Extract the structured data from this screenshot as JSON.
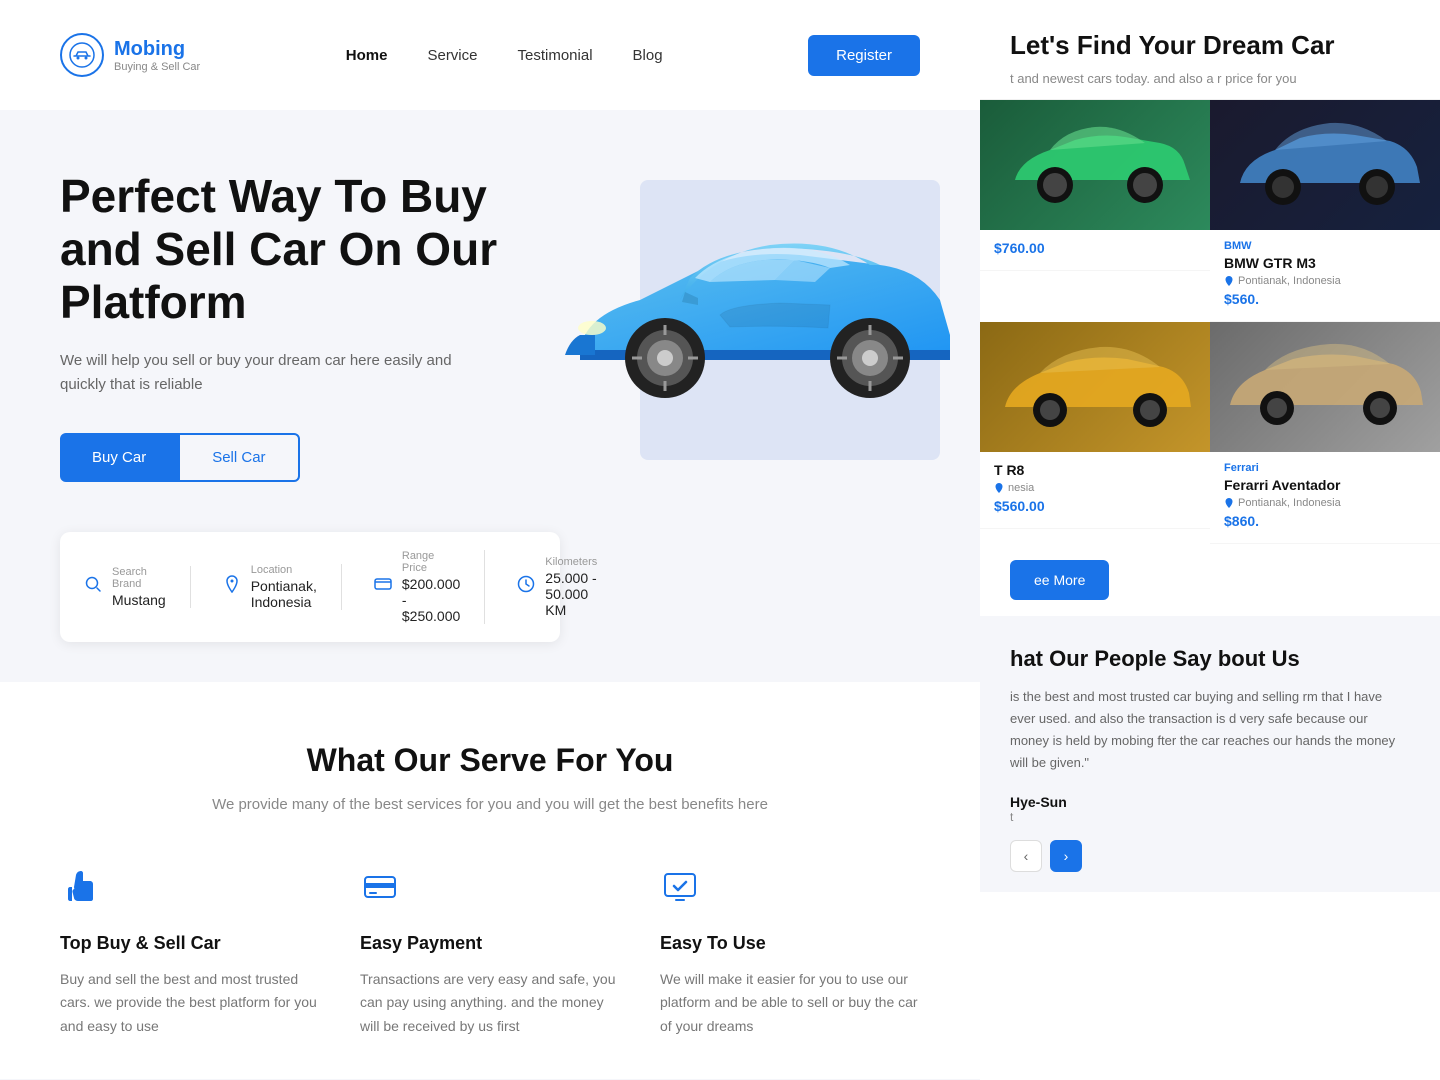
{
  "logo": {
    "name": "Mobing",
    "subtitle": "Buying & Sell Car"
  },
  "nav": {
    "items": [
      {
        "label": "Home",
        "active": true
      },
      {
        "label": "Service",
        "active": false
      },
      {
        "label": "Testimonial",
        "active": false
      },
      {
        "label": "Blog",
        "active": false
      }
    ],
    "register_label": "Register"
  },
  "hero": {
    "title": "Perfect Way To Buy and Sell Car On Our Platform",
    "description": "We will help you sell or buy your dream car here easily and quickly that is reliable",
    "btn_buy": "Buy Car",
    "btn_sell": "Sell Car"
  },
  "search": {
    "brand_label": "Search Brand",
    "brand_value": "Mustang",
    "location_label": "Location",
    "location_value": "Pontianak, Indonesia",
    "price_label": "Range Price",
    "price_value": "$200.000 - $250.000",
    "km_label": "Kilometers",
    "km_value": "25.000 - 50.000 KM"
  },
  "services": {
    "section_title": "What Our Serve For You",
    "section_desc": "We provide many of the best services for you and you will get the\nbest benefits here",
    "cards": [
      {
        "name": "Top Buy & Sell Car",
        "description": "Buy and sell the best and most trusted cars. we provide the best platform for you and easy to use"
      },
      {
        "name": "Easy Payment",
        "description": "Transactions are very easy and safe, you can pay using anything. and the money will be received by us first"
      },
      {
        "name": "Easy To Use",
        "description": "We will make it easier for you to use our platform and be able to sell or buy the car of your dreams"
      }
    ]
  },
  "right_panel": {
    "title": "Let's Find Your Dream Car",
    "description": "t and newest cars today. and also a\nr price for you",
    "cars": [
      {
        "brand": "",
        "model": "",
        "location": "",
        "price": "$760.00",
        "color_class": "car-green"
      },
      {
        "brand": "BMW",
        "model": "BMW GTR M3",
        "location": "Pontianak, Indonesia",
        "price": "$560.",
        "color_class": "car-bmw"
      },
      {
        "brand": "",
        "model": "T R8",
        "location": "nesia",
        "price": "$560.00",
        "color_class": "car-audi"
      },
      {
        "brand": "Ferrari",
        "model": "Ferarri Aventador",
        "location": "Pontianak, Indonesia",
        "price": "$860.",
        "color_class": "car-ferrari"
      }
    ],
    "see_more_label": "ee More",
    "testimonial": {
      "title": "hat Our People Say\nbout Us",
      "text": "is the best and most trusted car buying and selling rm that I have ever used. and also the transaction is d very safe because our money is held by mobing fter the car reaches our hands the money will be given.\"",
      "author": "Hye-Sun",
      "role": "t"
    }
  }
}
